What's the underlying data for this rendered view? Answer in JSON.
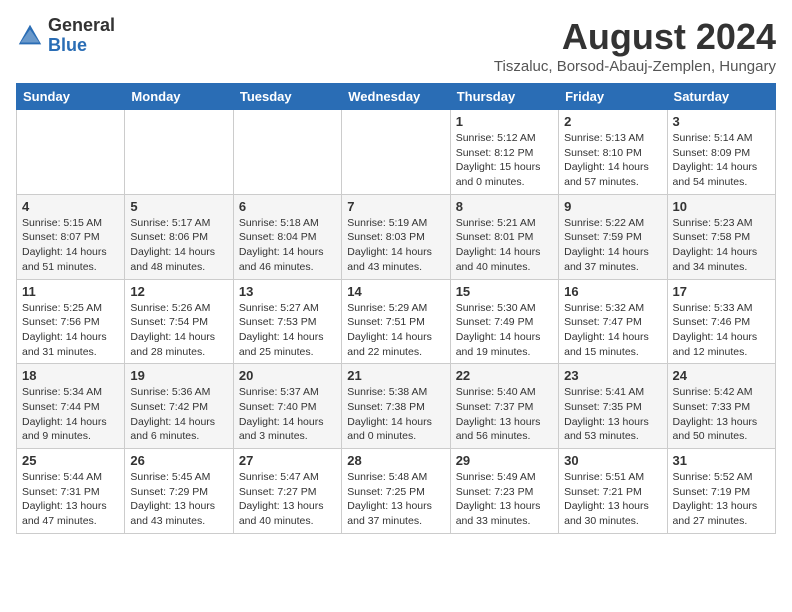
{
  "logo": {
    "general": "General",
    "blue": "Blue"
  },
  "header": {
    "month_year": "August 2024",
    "location": "Tiszaluc, Borsod-Abauj-Zemplen, Hungary"
  },
  "weekdays": [
    "Sunday",
    "Monday",
    "Tuesday",
    "Wednesday",
    "Thursday",
    "Friday",
    "Saturday"
  ],
  "weeks": [
    [
      {
        "day": "",
        "detail": ""
      },
      {
        "day": "",
        "detail": ""
      },
      {
        "day": "",
        "detail": ""
      },
      {
        "day": "",
        "detail": ""
      },
      {
        "day": "1",
        "detail": "Sunrise: 5:12 AM\nSunset: 8:12 PM\nDaylight: 15 hours and 0 minutes."
      },
      {
        "day": "2",
        "detail": "Sunrise: 5:13 AM\nSunset: 8:10 PM\nDaylight: 14 hours and 57 minutes."
      },
      {
        "day": "3",
        "detail": "Sunrise: 5:14 AM\nSunset: 8:09 PM\nDaylight: 14 hours and 54 minutes."
      }
    ],
    [
      {
        "day": "4",
        "detail": "Sunrise: 5:15 AM\nSunset: 8:07 PM\nDaylight: 14 hours and 51 minutes."
      },
      {
        "day": "5",
        "detail": "Sunrise: 5:17 AM\nSunset: 8:06 PM\nDaylight: 14 hours and 48 minutes."
      },
      {
        "day": "6",
        "detail": "Sunrise: 5:18 AM\nSunset: 8:04 PM\nDaylight: 14 hours and 46 minutes."
      },
      {
        "day": "7",
        "detail": "Sunrise: 5:19 AM\nSunset: 8:03 PM\nDaylight: 14 hours and 43 minutes."
      },
      {
        "day": "8",
        "detail": "Sunrise: 5:21 AM\nSunset: 8:01 PM\nDaylight: 14 hours and 40 minutes."
      },
      {
        "day": "9",
        "detail": "Sunrise: 5:22 AM\nSunset: 7:59 PM\nDaylight: 14 hours and 37 minutes."
      },
      {
        "day": "10",
        "detail": "Sunrise: 5:23 AM\nSunset: 7:58 PM\nDaylight: 14 hours and 34 minutes."
      }
    ],
    [
      {
        "day": "11",
        "detail": "Sunrise: 5:25 AM\nSunset: 7:56 PM\nDaylight: 14 hours and 31 minutes."
      },
      {
        "day": "12",
        "detail": "Sunrise: 5:26 AM\nSunset: 7:54 PM\nDaylight: 14 hours and 28 minutes."
      },
      {
        "day": "13",
        "detail": "Sunrise: 5:27 AM\nSunset: 7:53 PM\nDaylight: 14 hours and 25 minutes."
      },
      {
        "day": "14",
        "detail": "Sunrise: 5:29 AM\nSunset: 7:51 PM\nDaylight: 14 hours and 22 minutes."
      },
      {
        "day": "15",
        "detail": "Sunrise: 5:30 AM\nSunset: 7:49 PM\nDaylight: 14 hours and 19 minutes."
      },
      {
        "day": "16",
        "detail": "Sunrise: 5:32 AM\nSunset: 7:47 PM\nDaylight: 14 hours and 15 minutes."
      },
      {
        "day": "17",
        "detail": "Sunrise: 5:33 AM\nSunset: 7:46 PM\nDaylight: 14 hours and 12 minutes."
      }
    ],
    [
      {
        "day": "18",
        "detail": "Sunrise: 5:34 AM\nSunset: 7:44 PM\nDaylight: 14 hours and 9 minutes."
      },
      {
        "day": "19",
        "detail": "Sunrise: 5:36 AM\nSunset: 7:42 PM\nDaylight: 14 hours and 6 minutes."
      },
      {
        "day": "20",
        "detail": "Sunrise: 5:37 AM\nSunset: 7:40 PM\nDaylight: 14 hours and 3 minutes."
      },
      {
        "day": "21",
        "detail": "Sunrise: 5:38 AM\nSunset: 7:38 PM\nDaylight: 14 hours and 0 minutes."
      },
      {
        "day": "22",
        "detail": "Sunrise: 5:40 AM\nSunset: 7:37 PM\nDaylight: 13 hours and 56 minutes."
      },
      {
        "day": "23",
        "detail": "Sunrise: 5:41 AM\nSunset: 7:35 PM\nDaylight: 13 hours and 53 minutes."
      },
      {
        "day": "24",
        "detail": "Sunrise: 5:42 AM\nSunset: 7:33 PM\nDaylight: 13 hours and 50 minutes."
      }
    ],
    [
      {
        "day": "25",
        "detail": "Sunrise: 5:44 AM\nSunset: 7:31 PM\nDaylight: 13 hours and 47 minutes."
      },
      {
        "day": "26",
        "detail": "Sunrise: 5:45 AM\nSunset: 7:29 PM\nDaylight: 13 hours and 43 minutes."
      },
      {
        "day": "27",
        "detail": "Sunrise: 5:47 AM\nSunset: 7:27 PM\nDaylight: 13 hours and 40 minutes."
      },
      {
        "day": "28",
        "detail": "Sunrise: 5:48 AM\nSunset: 7:25 PM\nDaylight: 13 hours and 37 minutes."
      },
      {
        "day": "29",
        "detail": "Sunrise: 5:49 AM\nSunset: 7:23 PM\nDaylight: 13 hours and 33 minutes."
      },
      {
        "day": "30",
        "detail": "Sunrise: 5:51 AM\nSunset: 7:21 PM\nDaylight: 13 hours and 30 minutes."
      },
      {
        "day": "31",
        "detail": "Sunrise: 5:52 AM\nSunset: 7:19 PM\nDaylight: 13 hours and 27 minutes."
      }
    ]
  ]
}
